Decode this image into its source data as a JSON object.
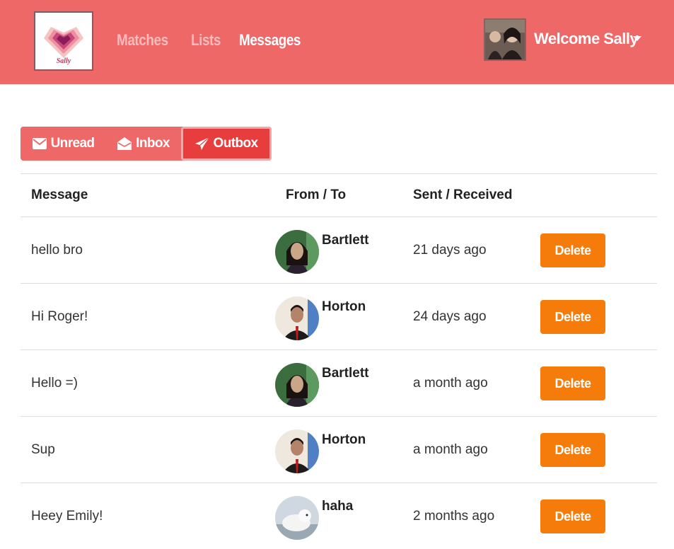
{
  "brand": {
    "logo_text": "Sally"
  },
  "nav": {
    "links": [
      {
        "label": "Matches",
        "active": false
      },
      {
        "label": "Lists",
        "active": false
      },
      {
        "label": "Messages",
        "active": true
      }
    ]
  },
  "user": {
    "welcome": "Welcome Sally",
    "icon": "chevron-down-icon"
  },
  "tabs": [
    {
      "label": "Unread",
      "icon": "envelope-icon"
    },
    {
      "label": "Inbox",
      "icon": "envelope-open-icon"
    },
    {
      "label": "Outbox",
      "icon": "paper-plane-icon",
      "active": true
    }
  ],
  "table": {
    "headers": [
      "Message",
      "From / To",
      "Sent / Received"
    ],
    "rows": [
      {
        "message": "hello bro",
        "name": "Bartlett",
        "sent": "21 days ago",
        "action": "Delete"
      },
      {
        "message": "Hi Roger!",
        "name": "Horton",
        "sent": "24 days ago",
        "action": "Delete"
      },
      {
        "message": "Hello =)",
        "name": "Bartlett",
        "sent": "a month ago",
        "action": "Delete"
      },
      {
        "message": "Sup",
        "name": "Horton",
        "sent": "a month ago",
        "action": "Delete"
      },
      {
        "message": "Heey Emily!",
        "name": "haha",
        "sent": "2 months ago",
        "action": "Delete"
      }
    ]
  },
  "colors": {
    "navbar": "#ee6868",
    "tab_active": "#e83d3d",
    "delete": "#f57c0a"
  }
}
